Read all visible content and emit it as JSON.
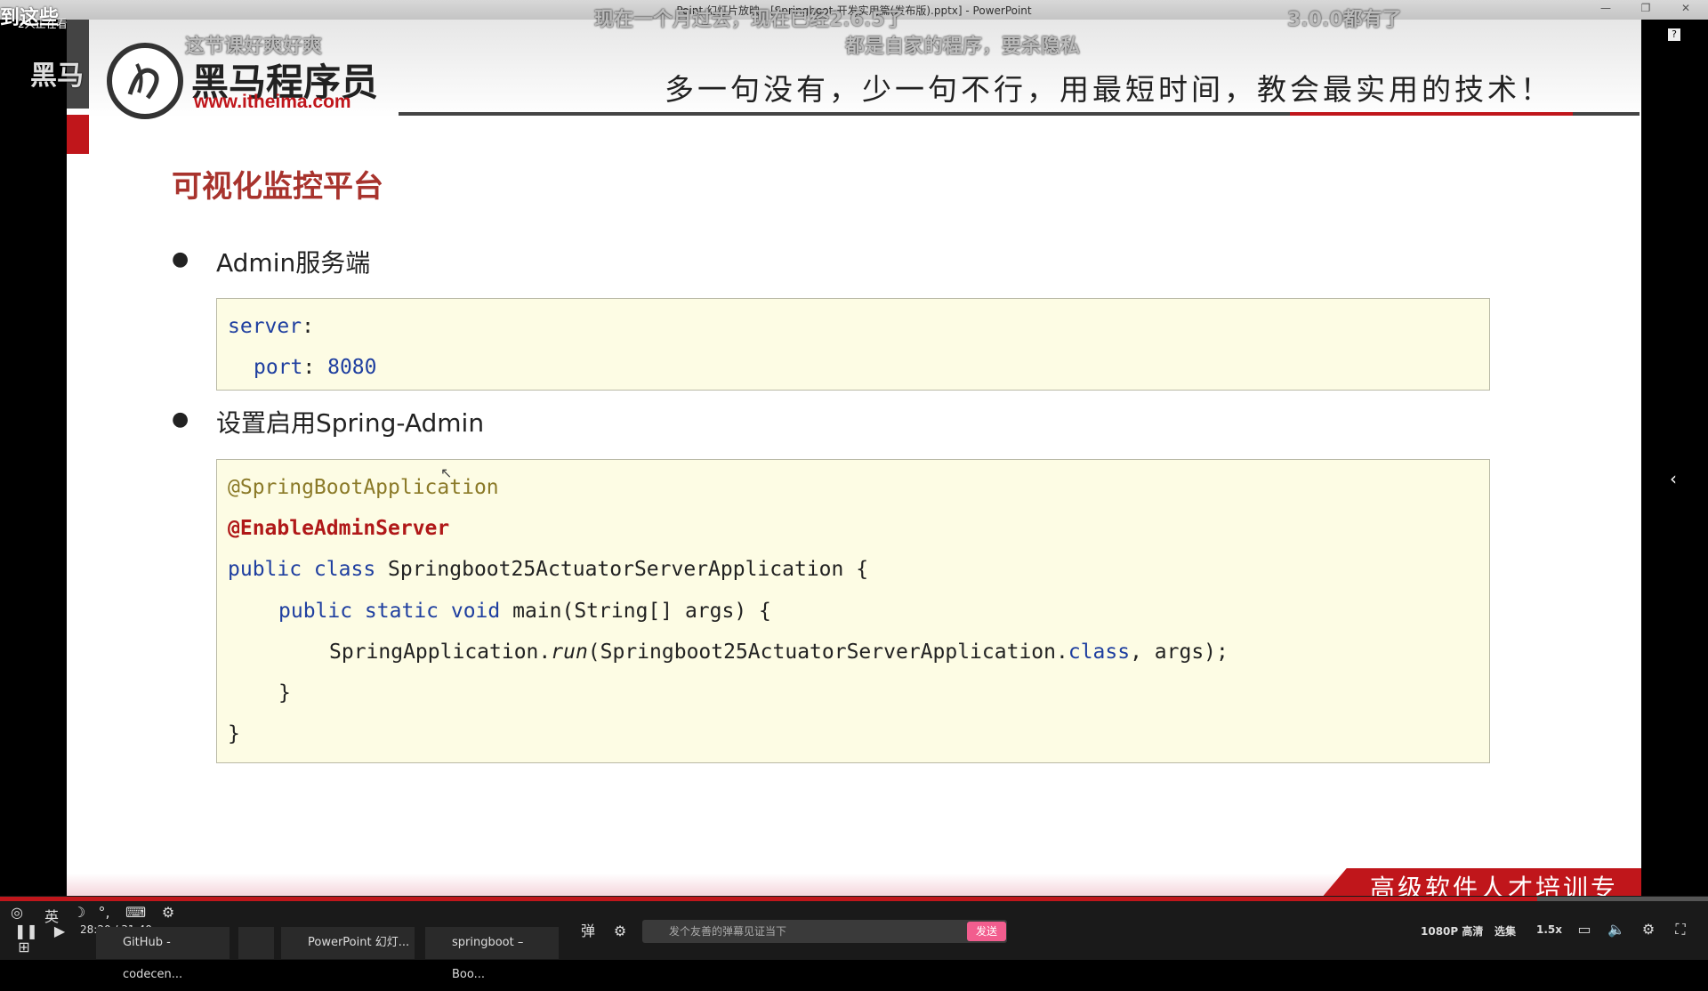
{
  "window": {
    "title": "Point 幻灯片放映 - [Springboot-开发实用篇(发布版).pptx] - PowerPoint"
  },
  "slide": {
    "logo_name": "黑马程序员",
    "logo_url": "www.itheima.com",
    "slogan": "多一句没有，少一句不行，用最短时间，教会最实用的技术！",
    "title": "可视化监控平台",
    "bullet1": "Admin服务端",
    "bullet2": "设置启用Spring-Admin",
    "code1": {
      "l1_key": "server",
      "l1_colon": ":",
      "l2_key": "port",
      "l2_colon": ": ",
      "l2_val": "8080"
    },
    "code2": {
      "ann1": "@SpringBootApplication",
      "ann2": "@EnableAdminServer",
      "cls_kw": "public class",
      "cls_name": " Springboot25ActuatorServerApplication {",
      "main_kw": "public static void",
      "main_rest": " main(String[] args) {",
      "run_pre": "SpringApplication.",
      "run_it": "run",
      "run_mid": "(Springboot25ActuatorServerApplication.",
      "run_kw": "class",
      "run_end": ", args);",
      "close1": "}",
      "close2": "}"
    },
    "footer": "高级软件人才培训专家"
  },
  "danmaku": [
    "现在一个月过去，现在已经2.6.5了",
    "3.0.0都有了",
    "这节课好爽好爽",
    "都是自家的程序，要杀隐私",
    "到这些",
    "2人正在看",
    "黑马"
  ],
  "player": {
    "time": "28:20 / 31:40",
    "progress": 0.9,
    "input_mode": "英",
    "danmu_placeholder": "发个友善的弹幕见证当下",
    "send": "发送",
    "quality": "1080P 高清",
    "select": "选集",
    "speed": "1.5x"
  },
  "taskbar": [
    {
      "label": "GitHub - codecen..."
    },
    {
      "label": "PowerPoint 幻灯..."
    },
    {
      "label": "springboot – Boo..."
    }
  ],
  "colors": {
    "accent": "#c0161b",
    "code_bg": "#fdfce4",
    "keyword": "#1f3fa0"
  }
}
